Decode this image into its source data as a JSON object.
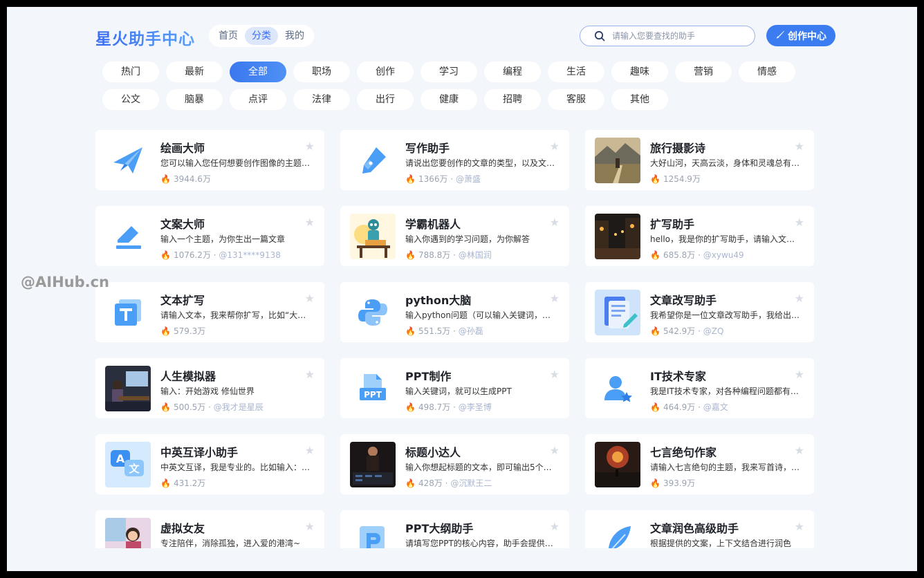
{
  "header": {
    "logo": "星火助手中心",
    "tabs": [
      {
        "label": "首页",
        "active": false
      },
      {
        "label": "分类",
        "active": true
      },
      {
        "label": "我的",
        "active": false
      }
    ],
    "search_placeholder": "请输入您要查找的助手",
    "create_label": "创作中心"
  },
  "categories": {
    "row1": [
      "热门",
      "最新",
      "全部",
      "职场",
      "创作",
      "学习",
      "编程",
      "生活",
      "趣味",
      "营销",
      "情感"
    ],
    "row2": [
      "公文",
      "脑暴",
      "点评",
      "法律",
      "出行",
      "健康",
      "招聘",
      "客服",
      "其他"
    ],
    "active": "全部"
  },
  "cards": [
    {
      "title": "绘画大师",
      "desc": "您可以输入您任何想要创作图像的主题…",
      "count": "3944.6万",
      "author": "",
      "icon": "paper-plane-icon"
    },
    {
      "title": "写作助手",
      "desc": "请说出您要创作的文章的类型，以及文…",
      "count": "1366万",
      "author": "@萧盛",
      "icon": "pen-nib-icon"
    },
    {
      "title": "旅行摄影诗",
      "desc": "大好山河，天高云淡，身体和灵魂总有…",
      "count": "1254.9万",
      "author": "",
      "icon": "travel-photo"
    },
    {
      "title": "文案大师",
      "desc": "输入一个主题，为你生出一篇文章",
      "count": "1076.2万",
      "author": "@131****9138",
      "icon": "eraser-icon"
    },
    {
      "title": "学霸机器人",
      "desc": "输入你遇到的学习问题，为你解答",
      "count": "788.8万",
      "author": "@林国润",
      "icon": "robot-image"
    },
    {
      "title": "扩写助手",
      "desc": "hello，我是你的扩写助手，请输入文本…",
      "count": "685.8万",
      "author": "@xywu49",
      "icon": "night-street-image"
    },
    {
      "title": "文本扩写",
      "desc": "请输入文本，我来帮你扩写，比如“大语…",
      "count": "579.3万",
      "author": "",
      "icon": "text-t-icon"
    },
    {
      "title": "python大脑",
      "desc": "输入python问题（可以输入关键词，可…",
      "count": "551.5万",
      "author": "@孙磊",
      "icon": "python-icon"
    },
    {
      "title": "文章改写助手",
      "desc": "我希望你是一位文章改写助手，我给出…",
      "count": "542.9万",
      "author": "@ZQ",
      "icon": "document-edit-icon"
    },
    {
      "title": "人生模拟器",
      "desc": "输入：开始游戏 修仙世界",
      "count": "500.5万",
      "author": "@我才是星辰",
      "icon": "gamer-image"
    },
    {
      "title": "PPT制作",
      "desc": "输入关键词，就可以生成PPT",
      "count": "498.7万",
      "author": "@李圣博",
      "icon": "ppt-file-icon"
    },
    {
      "title": "IT技术专家",
      "desc": "我是IT技术专家，对各种编程问题都有…",
      "count": "464.9万",
      "author": "@嘉文",
      "icon": "user-star-icon"
    },
    {
      "title": "中英互译小助手",
      "desc": "中英文互译，我是专业的。比如输入：…",
      "count": "431.2万",
      "author": "",
      "icon": "translate-icon"
    },
    {
      "title": "标题小达人",
      "desc": "输入你想起标题的文本，即可输出5个文…",
      "count": "428万",
      "author": "@沉默王二",
      "icon": "presenter-image"
    },
    {
      "title": "七言绝句作家",
      "desc": "请输入七言绝句的主题，我来写首诗，…",
      "count": "393.9万",
      "author": "",
      "icon": "fire-scene-image"
    },
    {
      "title": "虚拟女友",
      "desc": "专注陪伴，消除孤独，进入爱的港湾~",
      "count": "",
      "author": "",
      "icon": "girl-image"
    },
    {
      "title": "PPT大纲助手",
      "desc": "请填写您PPT的核心内容，助手会提供…",
      "count": "",
      "author": "",
      "icon": "ppt-outline-icon"
    },
    {
      "title": "文章润色高级助手",
      "desc": "根据提供的文案，上下文结合进行润色",
      "count": "",
      "author": "",
      "icon": "feather-icon"
    }
  ],
  "watermark": "@AIHub.cn",
  "colors": {
    "accent": "#3b7cf0",
    "page_bg": "#f3f6fb",
    "icon_blue": "#4a9ef5"
  }
}
